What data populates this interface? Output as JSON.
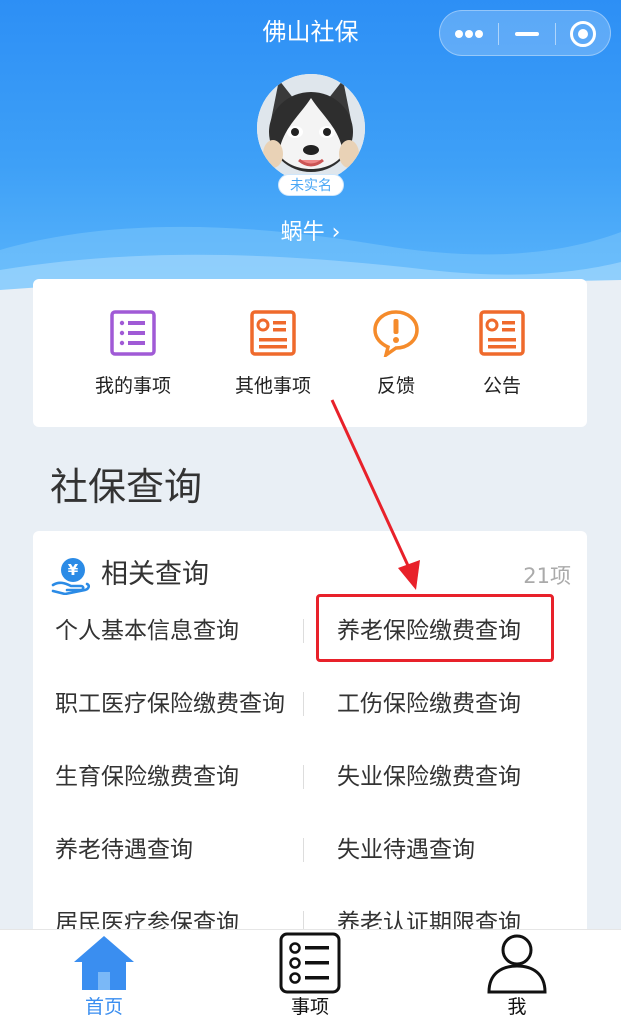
{
  "nav": {
    "title": "佛山社保",
    "menu_icon": "more-dots-icon",
    "minimize_icon": "minimize-icon",
    "close_icon": "target-circle-icon"
  },
  "profile": {
    "badge": "未实名",
    "name": "蜗牛 ›"
  },
  "quick_actions": [
    {
      "label": "我的事项",
      "icon": "list-icon",
      "color": "#a05ad6"
    },
    {
      "label": "其他事项",
      "icon": "card-icon",
      "color": "#ef6a2c"
    },
    {
      "label": "反馈",
      "icon": "feedback-bubble-icon",
      "color": "#f58b2b"
    },
    {
      "label": "公告",
      "icon": "notice-icon",
      "color": "#ef6a2c"
    }
  ],
  "section_title": "社保查询",
  "query": {
    "title": "相关查询",
    "count": "21项",
    "items": [
      [
        "个人基本信息查询",
        "养老保险缴费查询"
      ],
      [
        "职工医疗保险缴费查询",
        "工伤保险缴费查询"
      ],
      [
        "生育保险缴费查询",
        "失业保险缴费查询"
      ],
      [
        "养老待遇查询",
        "失业待遇查询"
      ],
      [
        "居民医疗参保查询",
        "养老认证期限查询"
      ]
    ]
  },
  "tabs": [
    {
      "label": "首页",
      "icon": "home-icon",
      "active": true
    },
    {
      "label": "事项",
      "icon": "task-list-icon",
      "active": false
    },
    {
      "label": "我",
      "icon": "user-icon",
      "active": false
    }
  ],
  "colors": {
    "accent": "#3a8ef0",
    "highlight": "#e8212a",
    "header_blue": "#2d8ff5"
  }
}
